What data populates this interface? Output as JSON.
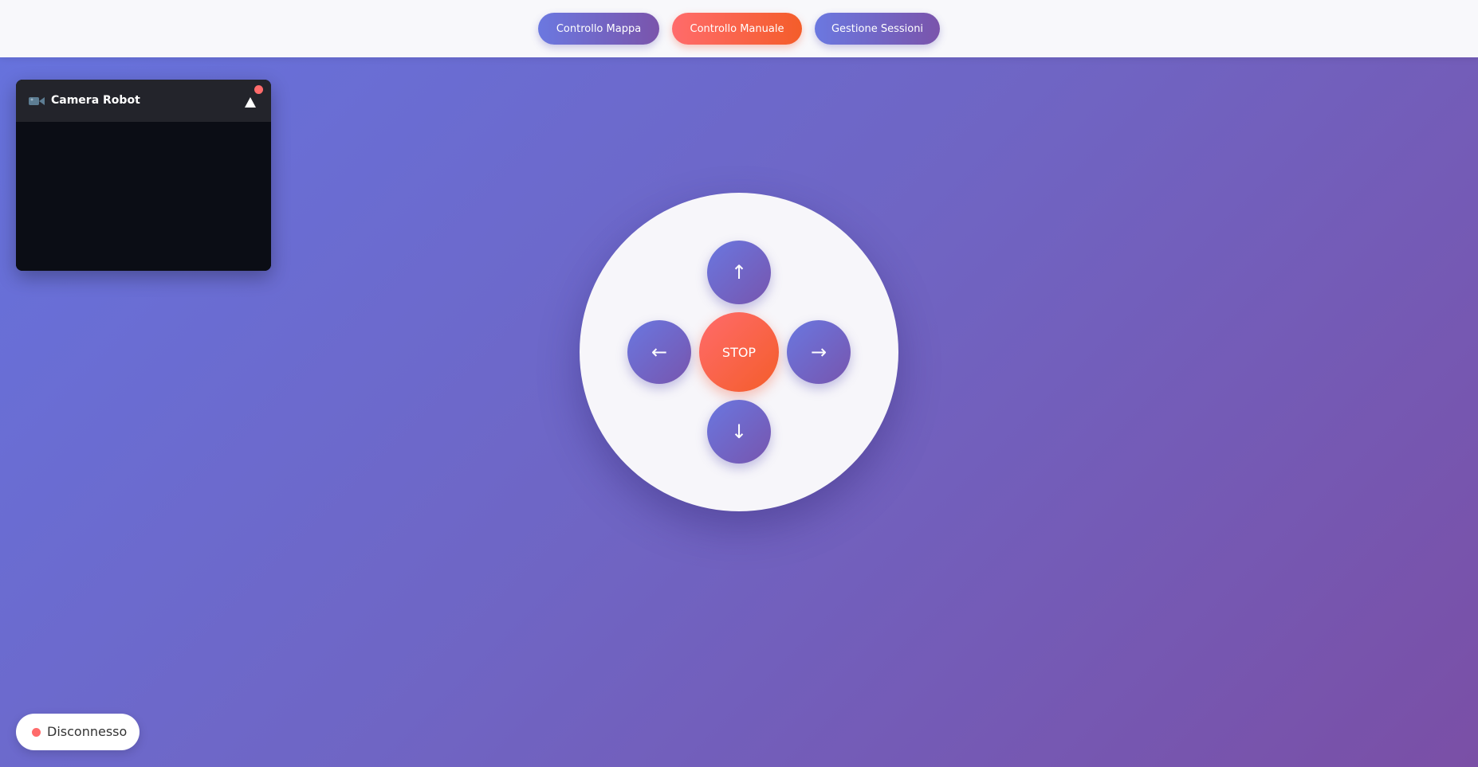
{
  "nav": {
    "tabs": [
      {
        "label": "Controllo Mappa",
        "active": false
      },
      {
        "label": "Controllo Manuale",
        "active": true
      },
      {
        "label": "Gestione Sessioni",
        "active": false
      }
    ]
  },
  "camera": {
    "title": "Camera Robot",
    "icon": "video-camera-icon",
    "toggle_icon": "triangle-up-icon",
    "recording_indicator_color": "#ff6b6b"
  },
  "controls": {
    "up_label": "↑",
    "left_label": "←",
    "stop_label": "STOP",
    "right_label": "→",
    "down_label": "↓"
  },
  "status": {
    "text": "Disconnesso",
    "color": "#ff6b6b"
  },
  "colors": {
    "accent_purple": "#6b78e0",
    "accent_orange": "#f45d2a",
    "background_start": "#6673de",
    "background_end": "#7a4fa6"
  }
}
